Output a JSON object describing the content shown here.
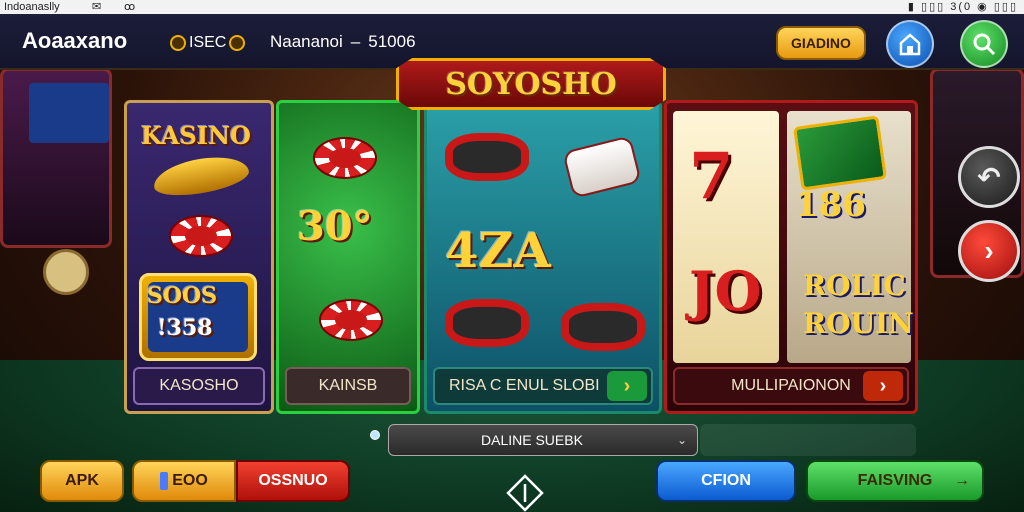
{
  "status_bar": {
    "left_text": "Indoanaslly",
    "icon1": "✉",
    "icon2": "ꝏ",
    "right_text": "▮ ▯▯▯ 3(0 ◉ ▯▯▯"
  },
  "header": {
    "brand": "Aoaaxano",
    "coin_value": "ISEC",
    "status_name": "Naananoi",
    "status_sep": "–",
    "status_value": "51006",
    "gold_button": "GIADINO"
  },
  "banner": {
    "title": "SOYOSHO"
  },
  "panels": [
    {
      "title": "KASINO",
      "box_top": "SOOS",
      "box_bottom": "!358",
      "footer": "KASOSHO"
    },
    {
      "big_number": "30°",
      "footer": "KAINSB"
    },
    {
      "big_number": "4ZA",
      "footer": "RISA C ENUL SLOBI",
      "footer_arrow": "›"
    },
    {
      "reel_a_top": "7",
      "reel_a_bottom": "JO",
      "reel_b_number": "186",
      "reel_b_word1": "ROLIC",
      "reel_b_word2": "ROUIN",
      "footer": "MULLIPAIONON",
      "footer_arrow": "›"
    }
  ],
  "side_buttons": {
    "top_icon": "↶",
    "bottom_icon": "›"
  },
  "status_field": {
    "value": "DALINE SUEBK",
    "caret": "⌄"
  },
  "bottom_bar": {
    "apk": "APK",
    "pair_left": "EOO",
    "pair_right": "OSSNUO",
    "blue": "CFION",
    "green": "FAISVING",
    "green_arrow": "→"
  },
  "colors": {
    "gold": "#f0b000",
    "red": "#d81e1e",
    "green": "#1a9a2a",
    "blue": "#0b5ad0",
    "header_bg": "#1c1e3a"
  },
  "icons": {
    "home": "home-icon",
    "search": "search-icon",
    "undo": "undo-icon",
    "next": "chevron-right-icon",
    "diamond": "diamond-icon"
  }
}
